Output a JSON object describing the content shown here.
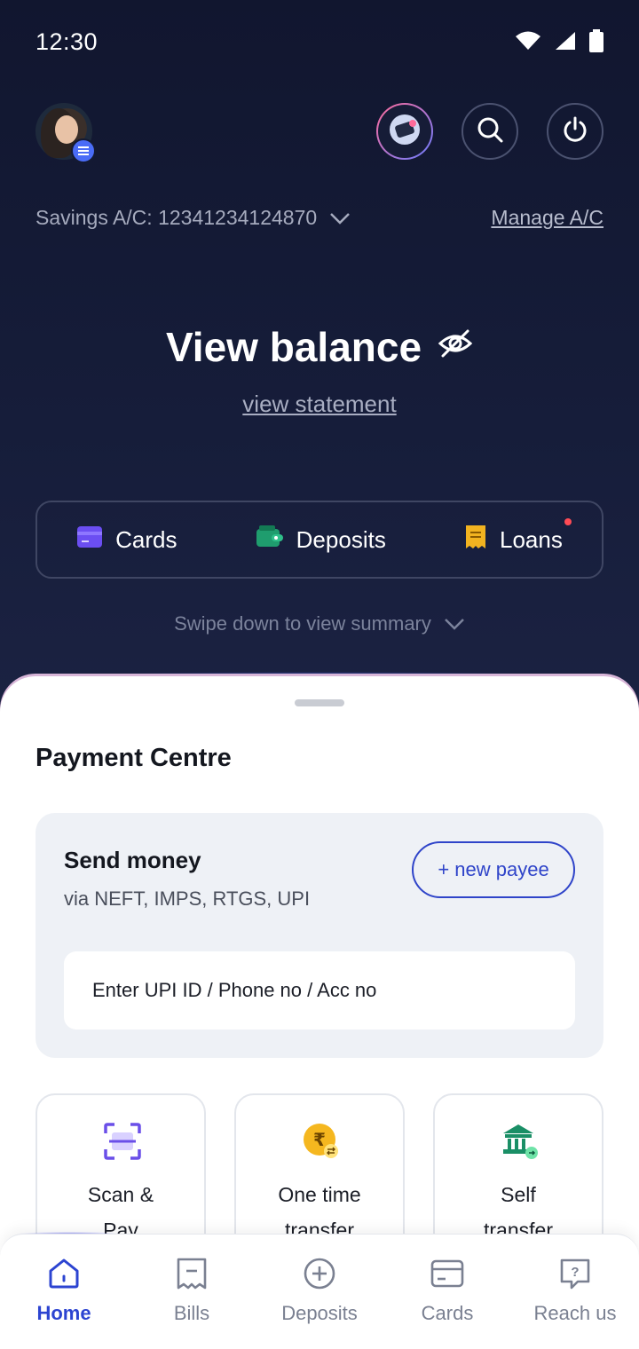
{
  "status_bar": {
    "time": "12:30"
  },
  "account": {
    "label": "Savings A/C: 12341234124870",
    "manage": "Manage A/C"
  },
  "balance": {
    "title": "View balance",
    "statement": "view statement"
  },
  "quick_links": [
    {
      "label": "Cards",
      "icon": "card-icon",
      "color": "#6b4ef2"
    },
    {
      "label": "Deposits",
      "icon": "wallet-icon",
      "color": "#1f9d6e"
    },
    {
      "label": "Loans",
      "icon": "loan-icon",
      "color": "#f2b320",
      "has_alert": true
    }
  ],
  "swipe_hint": "Swipe down to view summary",
  "payment_centre": {
    "title": "Payment Centre",
    "send_money": {
      "title": "Send money",
      "subtitle": "via NEFT, IMPS, RTGS, UPI",
      "new_payee": "+ new payee",
      "input_placeholder": "Enter UPI ID / Phone no / Acc no"
    },
    "tiles": [
      {
        "line1": "Scan &",
        "line2": "Pay",
        "icon": "scan-icon"
      },
      {
        "line1": "One time",
        "line2": "transfer",
        "icon": "rupee-transfer-icon"
      },
      {
        "line1": "Self",
        "line2": "transfer",
        "icon": "bank-icon"
      }
    ]
  },
  "bottom_nav": [
    {
      "label": "Home",
      "icon": "home-icon",
      "active": true
    },
    {
      "label": "Bills",
      "icon": "bill-icon",
      "active": false
    },
    {
      "label": "Deposits",
      "icon": "plus-circle-icon",
      "active": false
    },
    {
      "label": "Cards",
      "icon": "card-icon",
      "active": false
    },
    {
      "label": "Reach us",
      "icon": "help-chat-icon",
      "active": false
    }
  ],
  "colors": {
    "accent": "#2c44d1",
    "background_dark": "#141a33",
    "alert": "#ff4b55"
  }
}
